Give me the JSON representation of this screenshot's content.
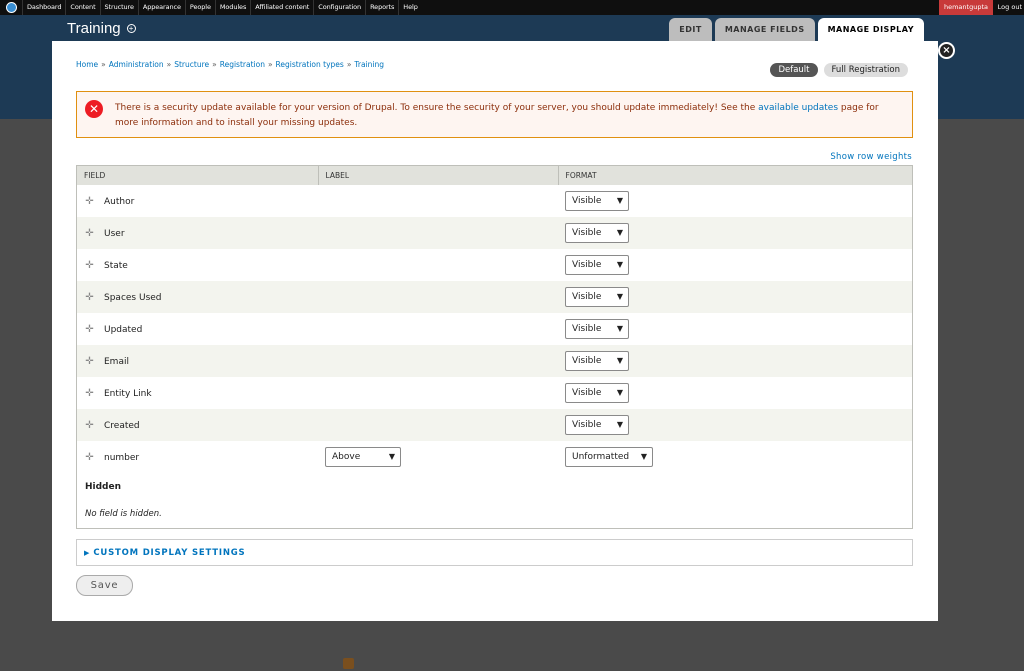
{
  "toolbar": {
    "items": [
      "Dashboard",
      "Content",
      "Structure",
      "Appearance",
      "People",
      "Modules",
      "Affiliated content",
      "Configuration",
      "Reports",
      "Help"
    ],
    "user": "hemantgupta",
    "logout": "Log out"
  },
  "overlay": {
    "title": "Training",
    "add_icon": "+",
    "close_icon": "×",
    "tabs": [
      {
        "label": "Edit",
        "active": false
      },
      {
        "label": "Manage fields",
        "active": false
      },
      {
        "label": "Manage display",
        "active": true
      }
    ]
  },
  "breadcrumb": [
    "Home",
    "Administration",
    "Structure",
    "Registration",
    "Registration types",
    "Training"
  ],
  "breadcrumb_sep": "»",
  "view_modes": [
    {
      "label": "Default",
      "active": true
    },
    {
      "label": "Full Registration",
      "active": false
    }
  ],
  "message": {
    "icon": "✕",
    "text_before": "There is a security update available for your version of Drupal. To ensure the security of your server, you should update immediately! See the ",
    "link": "available updates",
    "text_after": " page for more information and to install your missing updates."
  },
  "show_row_weights": "Show row weights",
  "table": {
    "headers": [
      "Field",
      "Label",
      "Format"
    ],
    "rows": [
      {
        "field": "Author",
        "label": "",
        "format": "Visible"
      },
      {
        "field": "User",
        "label": "",
        "format": "Visible"
      },
      {
        "field": "State",
        "label": "",
        "format": "Visible"
      },
      {
        "field": "Spaces Used",
        "label": "",
        "format": "Visible"
      },
      {
        "field": "Updated",
        "label": "",
        "format": "Visible"
      },
      {
        "field": "Email",
        "label": "",
        "format": "Visible"
      },
      {
        "field": "Entity Link",
        "label": "",
        "format": "Visible"
      },
      {
        "field": "Created",
        "label": "",
        "format": "Visible"
      },
      {
        "field": "number",
        "label": "Above",
        "format": "Unformatted"
      }
    ],
    "hidden_heading": "Hidden",
    "hidden_note": "No field is hidden."
  },
  "custom_settings": "Custom display settings",
  "save_label": "Save",
  "colors": {
    "accent_link": "#0074bd",
    "error_red": "#ed1c24",
    "toolbar_user": "#c83a3a"
  }
}
